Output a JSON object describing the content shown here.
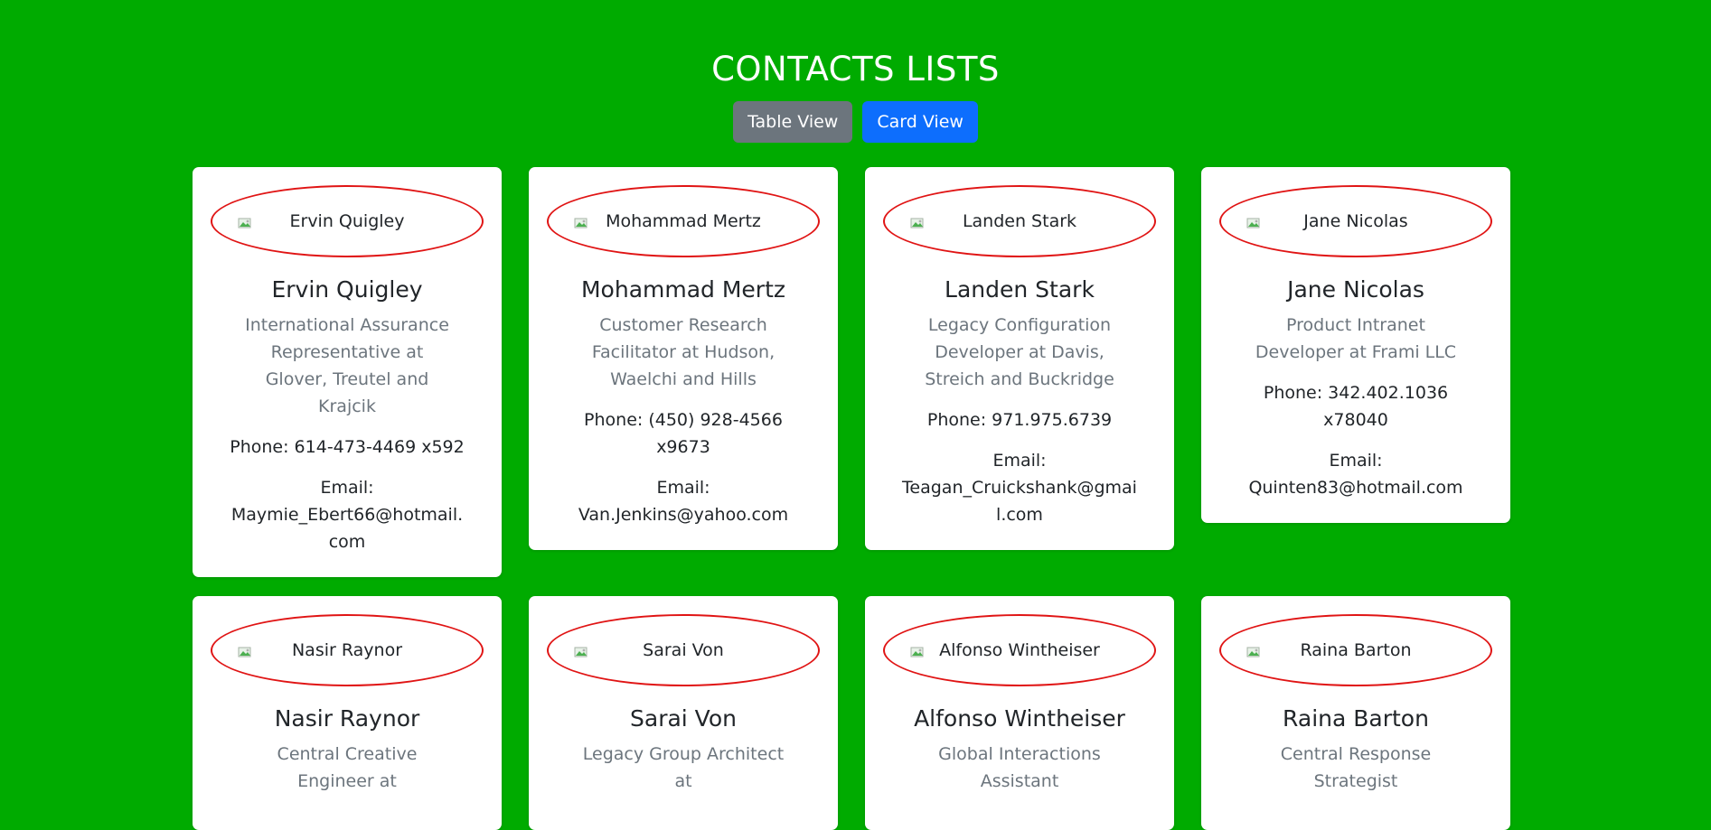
{
  "page": {
    "title": "CONTACTS LISTS"
  },
  "toolbar": {
    "table_view_label": "Table View",
    "card_view_label": "Card View"
  },
  "colors": {
    "background": "#00ab00",
    "table_button": "#6c757d",
    "card_button": "#0d6efd",
    "avatar_border": "#e01414"
  },
  "contacts": [
    {
      "avatar_alt": "Ervin Quigley",
      "name": "Ervin Quigley",
      "role": "International Assurance Representative at Glover, Treutel and Krajcik",
      "phone": "Phone: 614-473-4469 x592",
      "email_label": "Email:",
      "email": "Maymie_Ebert66@hotmail.com"
    },
    {
      "avatar_alt": "Mohammad Mertz",
      "name": "Mohammad Mertz",
      "role": "Customer Research Facilitator at Hudson, Waelchi and Hills",
      "phone": "Phone: (450) 928-4566 x9673",
      "email_label": "Email:",
      "email": "Van.Jenkins@yahoo.com"
    },
    {
      "avatar_alt": "Landen Stark",
      "name": "Landen Stark",
      "role": "Legacy Configuration Developer at Davis, Streich and Buckridge",
      "phone": "Phone: 971.975.6739",
      "email_label": "Email:",
      "email": "Teagan_Cruickshank@gmail.com"
    },
    {
      "avatar_alt": "Jane Nicolas",
      "name": "Jane Nicolas",
      "role": "Product Intranet Developer at Frami LLC",
      "phone": "Phone: 342.402.1036 x78040",
      "email_label": "Email:",
      "email": "Quinten83@hotmail.com"
    },
    {
      "avatar_alt": "Nasir Raynor",
      "name": "Nasir Raynor",
      "role": "Central Creative Engineer at",
      "phone": "",
      "email_label": "",
      "email": ""
    },
    {
      "avatar_alt": "Sarai Von",
      "name": "Sarai Von",
      "role": "Legacy Group Architect at",
      "phone": "",
      "email_label": "",
      "email": ""
    },
    {
      "avatar_alt": "Alfonso Wintheiser",
      "name": "Alfonso Wintheiser",
      "role": "Global Interactions Assistant",
      "phone": "",
      "email_label": "",
      "email": ""
    },
    {
      "avatar_alt": "Raina Barton",
      "name": "Raina Barton",
      "role": "Central Response Strategist",
      "phone": "",
      "email_label": "",
      "email": ""
    }
  ]
}
